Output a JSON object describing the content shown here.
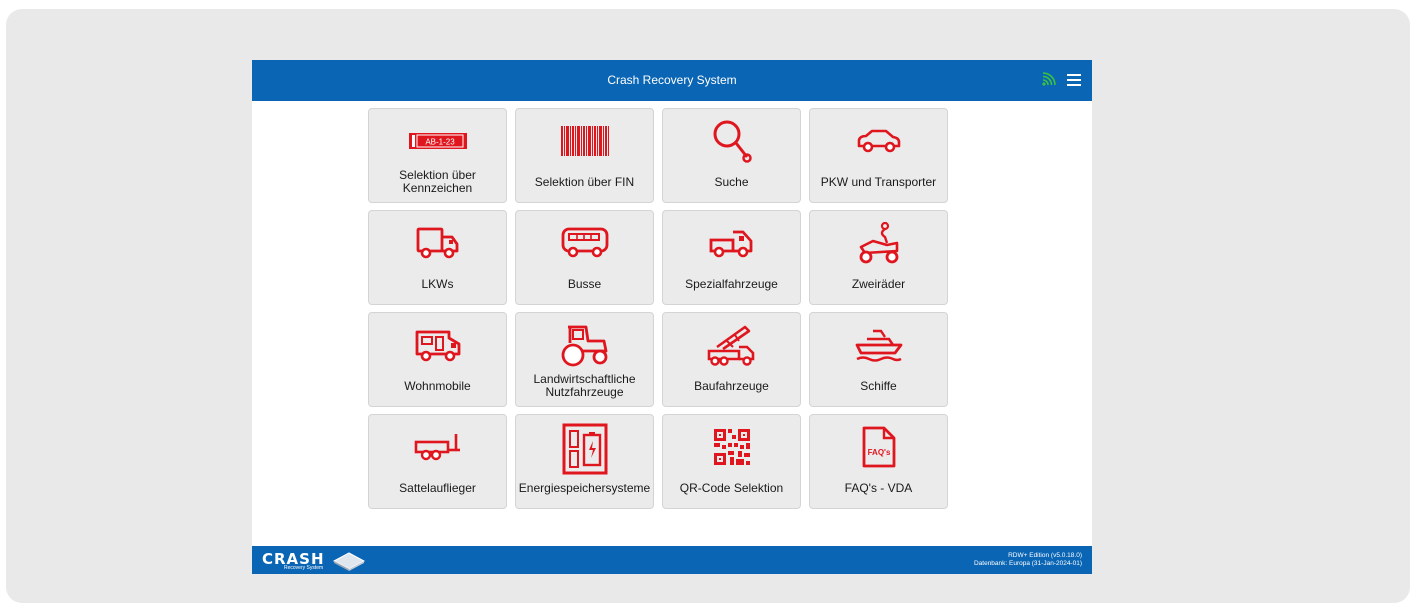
{
  "header": {
    "title": "Crash Recovery System",
    "status_icon": "signal-icon",
    "menu_icon": "hamburger-menu-icon"
  },
  "accent_color": "#e0161f",
  "bar_color": "#0a65b4",
  "tiles": [
    {
      "label": "Selektion über Kennzeichen",
      "icon": "license-plate-icon",
      "plate_text": "AB-1-23"
    },
    {
      "label": "Selektion über FIN",
      "icon": "barcode-icon"
    },
    {
      "label": "Suche",
      "icon": "magnifier-icon"
    },
    {
      "label": "PKW und Transporter",
      "icon": "car-icon"
    },
    {
      "label": "LKWs",
      "icon": "truck-icon"
    },
    {
      "label": "Busse",
      "icon": "bus-icon"
    },
    {
      "label": "Spezialfahrzeuge",
      "icon": "special-vehicle-icon"
    },
    {
      "label": "Zweiräder",
      "icon": "motorcycle-icon"
    },
    {
      "label": "Wohnmobile",
      "icon": "camper-icon"
    },
    {
      "label": "Landwirtschaftliche Nutzfahrzeuge",
      "icon": "tractor-icon"
    },
    {
      "label": "Baufahrzeuge",
      "icon": "crane-truck-icon"
    },
    {
      "label": "Schiffe",
      "icon": "ship-icon"
    },
    {
      "label": "Sattelauflieger",
      "icon": "trailer-icon"
    },
    {
      "label": "Energiespeichersysteme",
      "icon": "battery-icon"
    },
    {
      "label": "QR-Code Selektion",
      "icon": "qr-code-icon"
    },
    {
      "label": "FAQ's - VDA",
      "icon": "faq-document-icon",
      "doc_text": "FAQ's"
    }
  ],
  "footer": {
    "logo_text": "CRASH",
    "logo_subtext": "Recovery System",
    "edition": "RDW+ Edition (v5.0.18.0)",
    "database": "Datenbank: Europa (31-Jan-2024-01)"
  }
}
